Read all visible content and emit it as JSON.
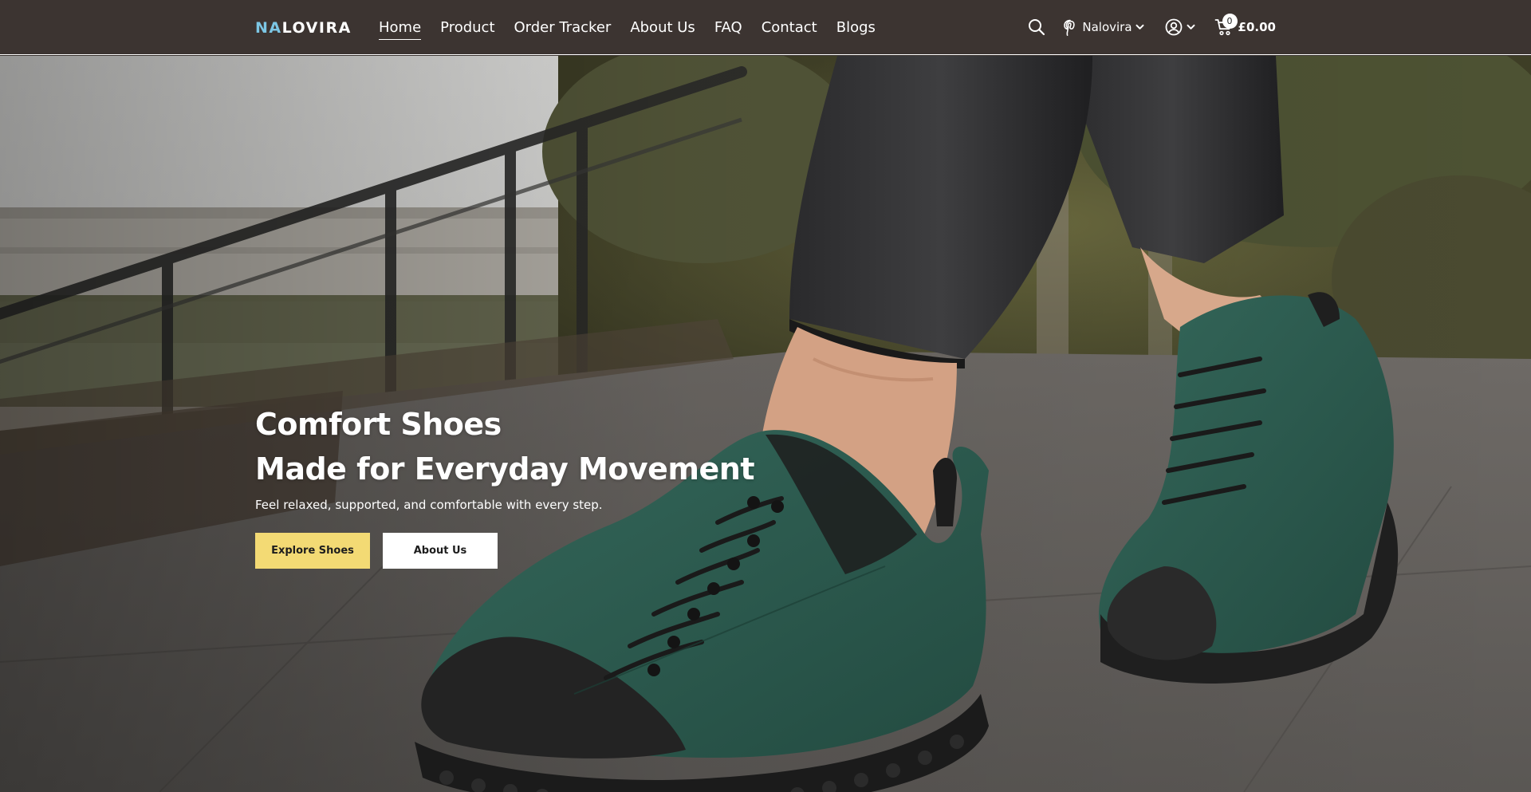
{
  "header": {
    "logo_accent": "NA",
    "logo_rest": "LOVIRA",
    "nav": [
      {
        "label": "Home",
        "active": true
      },
      {
        "label": "Product"
      },
      {
        "label": "Order Tracker"
      },
      {
        "label": "About Us"
      },
      {
        "label": "FAQ"
      },
      {
        "label": "Contact"
      },
      {
        "label": "Blogs"
      }
    ],
    "pinterest_label": "Nalovira",
    "cart_count": "0",
    "cart_total": "£0.00"
  },
  "hero": {
    "headline_line1": "Comfort Shoes",
    "headline_line2": "Made for Everyday Movement",
    "subline": "Feel relaxed, supported, and comfortable with every step.",
    "primary_button": "Explore Shoes",
    "secondary_button": "About Us"
  },
  "colors": {
    "header_bg": "#3c3431",
    "logo_accent": "#7cc6e4",
    "primary_button": "#f3da74",
    "shoe_green": "#2c5a4e"
  },
  "icons": [
    "search-icon",
    "pinterest-icon",
    "chevron-down-icon",
    "account-icon",
    "cart-icon"
  ]
}
